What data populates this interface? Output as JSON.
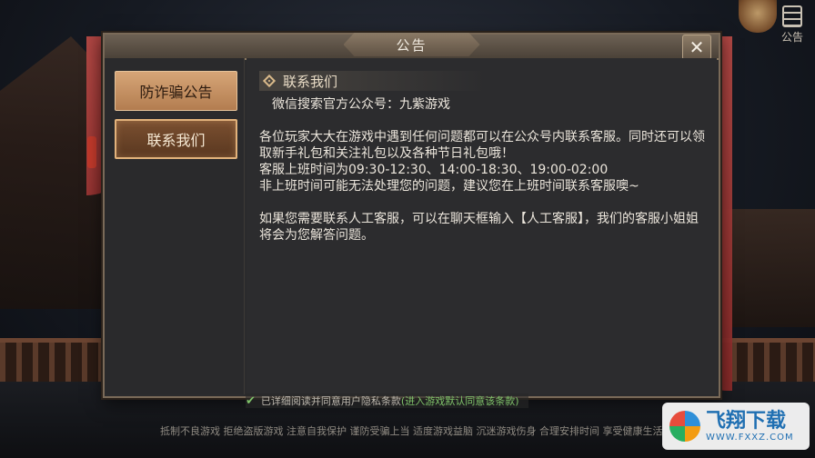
{
  "corner": {
    "label": "公告"
  },
  "dialog": {
    "title": "公告",
    "close_symbol": "✕",
    "nav": [
      {
        "label": "防诈骗公告",
        "state": "inactive"
      },
      {
        "label": "联系我们",
        "state": "active"
      }
    ],
    "section_title": "联系我们",
    "lines": {
      "wechat": "微信搜索官方公众号：九紫游戏",
      "p1": "各位玩家大大在游戏中遇到任何问题都可以在公众号内联系客服。同时还可以领取新手礼包和关注礼包以及各种节日礼包哦！",
      "hours": "客服上班时间为09:30-12:30、14:00-18:30、19:00-02:00",
      "offhours": "非上班时间可能无法处理您的问题，建议您在上班时间联系客服噢~",
      "p2": "如果您需要联系人工客服，可以在聊天框输入【人工客服】，我们的客服小姐姐将会为您解答问题。"
    }
  },
  "agreement": {
    "checked": true,
    "text": "已详细阅读并同意用户隐私条款",
    "highlight": "(进入游戏默认同意该条款)"
  },
  "footer": "抵制不良游戏 拒绝盗版游戏 注意自我保护 谨防受骗上当 适度游戏益脑 沉迷游戏伤身 合理安排时间 享受健康生活",
  "watermark": {
    "title": "飞翔下载",
    "url": "WWW.FXXZ.COM"
  },
  "colors": {
    "accent": "#e2b27b",
    "check": "#7fc36a",
    "panel": "#2b2b2d"
  }
}
